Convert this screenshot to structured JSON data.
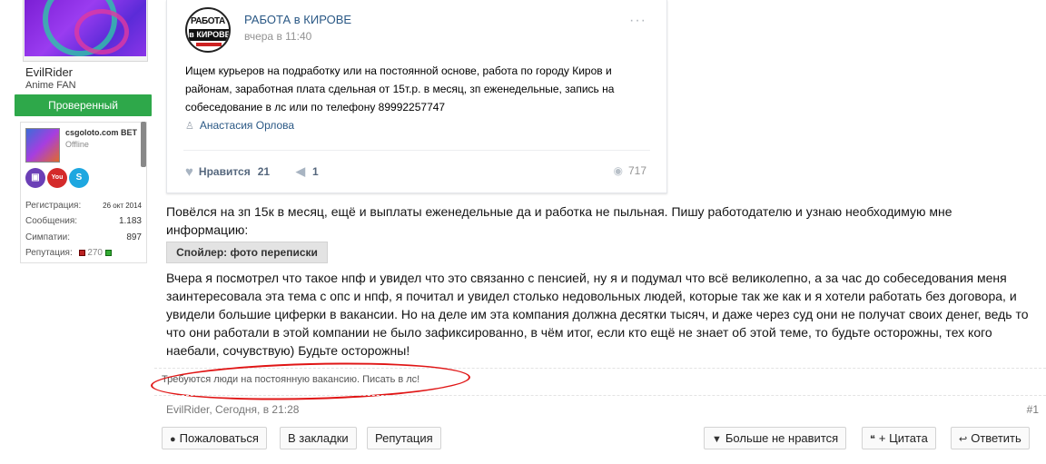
{
  "user": {
    "username": "EvilRider",
    "title": "Anime FAN",
    "badge": "Проверенный",
    "mini_name": "csgoloto.com BET",
    "mini_status": "Offline",
    "social": [
      "twitch-icon",
      "youtube-icon",
      "skype-icon"
    ],
    "stats": [
      {
        "label": "Регистрация:",
        "value": "26 окт 2014"
      },
      {
        "label": "Сообщения:",
        "value": "1.183"
      },
      {
        "label": "Симпатии:",
        "value": "897"
      },
      {
        "label": "Репутация:",
        "value": "270"
      }
    ]
  },
  "embed": {
    "logo_top": "РАБОТА",
    "logo_bottom": "в КИРОВЕ",
    "group_name": "РАБОТА в КИРОВЕ",
    "time": "вчера в 11:40",
    "text": "Ищем курьеров на подработку или на постоянной основе, работа по городу Киров и районам, заработная плата сдельная от 15т.р. в месяц, зп еженедельные, запись на собеседование в лс или по телефону 89992257747",
    "signer": "Анастасия Орлова",
    "like_label": "Нравится",
    "like_count": "21",
    "share_count": "1",
    "views": "717"
  },
  "post": {
    "paragraph1": "Повёлся на зп 15к в месяц, ещё и выплаты еженедельные да и работка не пыльная. Пишу работодателю и узнаю необходимую мне информацию:",
    "spoiler": "Спойлер: фото переписки",
    "paragraph2": "Вчера я посмотрел что такое нпф и увидел что это связанно с пенсией, ну я и подумал что всё великолепно, а за час до собеседования меня заинтересовала эта тема с опс и нпф, я почитал и увидел столько недовольных людей, которые так же как и я хотели работать без договора, и увидели большие циферки в вакансии. Но на деле им эта компания должна десятки тысяч, и даже через суд они не получат своих денег, ведь то что они работали в этой компании не было зафиксированно, в чём итог, если кто ещё не знает об этой теме, то будьте осторожны, тех кого наебали, сочувствую) Будьте осторожны!",
    "signature": "Требуются люди на постоянную вакансию. Писать в лс!",
    "author": "EvilRider",
    "date": "Сегодня, в 21:28",
    "number": "#1"
  },
  "actions": {
    "report": "Пожаловаться",
    "bookmark": "В закладки",
    "reputation": "Репутация",
    "unlike": "Больше не нравится",
    "quote": "+ Цитата",
    "reply": "Ответить"
  },
  "colors": {
    "accent_link": "#2a5885",
    "verified_green": "#2ea84a",
    "annotation_red": "#e01515"
  }
}
